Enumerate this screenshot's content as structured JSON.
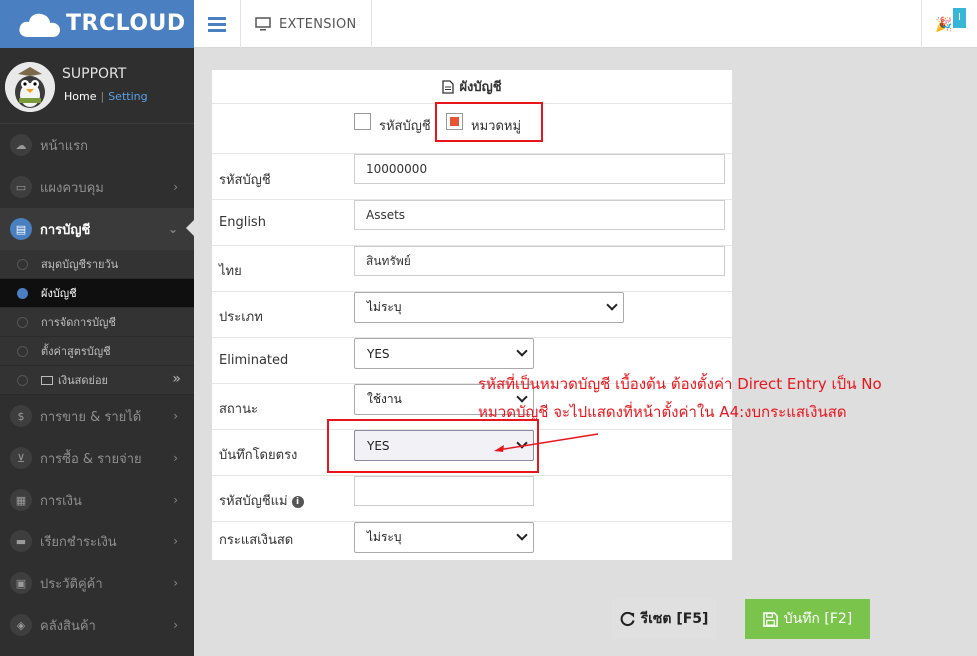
{
  "header": {
    "brand": "TRCLOUD",
    "extension_label": "EXTENSION",
    "notify_badge": "I"
  },
  "profile": {
    "name": "SUPPORT",
    "home": "Home",
    "separator": "|",
    "setting": "Setting"
  },
  "nav": {
    "items": [
      {
        "label": "หน้าแรก",
        "icon": "cloud-icon"
      },
      {
        "label": "แผงควบคุม",
        "icon": "monitor-icon"
      },
      {
        "label": "การบัญชี",
        "icon": "book-icon"
      },
      {
        "label": "การขาย & รายได้",
        "icon": "dollar-icon"
      },
      {
        "label": "การซื้อ & รายจ่าย",
        "icon": "cart-icon"
      },
      {
        "label": "การเงิน",
        "icon": "calendar-icon"
      },
      {
        "label": "เรียกชำระเงิน",
        "icon": "card-icon"
      },
      {
        "label": "ประวัติคู่ค้า",
        "icon": "contact-icon"
      },
      {
        "label": "คลังสินค้า",
        "icon": "boxes-icon"
      }
    ],
    "sub_items": [
      {
        "label": "สมุดบัญชีรายวัน"
      },
      {
        "label": "ผังบัญชี"
      },
      {
        "label": "การจัดการบัญชี"
      },
      {
        "label": "ตั้งค่าสูตรบัญชี"
      },
      {
        "label": "เงินสดย่อย"
      }
    ]
  },
  "form": {
    "title": "ผังบัญชี",
    "check_account_code": "รหัสบัญชี",
    "check_category": "หมวดหมู่",
    "fields": {
      "code_label": "รหัสบัญชี",
      "code_value": "10000000",
      "english_label": "English",
      "english_value": "Assets",
      "thai_label": "ไทย",
      "thai_value": "สินทรัพย์",
      "type_label": "ประเภท",
      "type_value": "ไม่ระบุ",
      "eliminated_label": "Eliminated",
      "eliminated_value": "YES",
      "status_label": "สถานะ",
      "status_value": "ใช้งาน",
      "direct_label": "บันทึกโดยตรง",
      "direct_value": "YES",
      "parent_label": "รหัสบัญชีแม่",
      "parent_value": "",
      "cashflow_label": "กระแสเงินสด",
      "cashflow_value": "ไม่ระบุ"
    }
  },
  "annotation": {
    "line1": "รหัสที่เป็นหมวดบัญชี เบื้องต้น ต้องตั้งค่า Direct Entry เป็น No",
    "line2": "หมวดบัญชี จะไปแสดงที่หน้าตั้งค่าใน A4:งบกระแสเงินสด",
    "color": "#e8161c"
  },
  "buttons": {
    "reset": "รีเซต [F5]",
    "save": "บันทึก [F2]"
  },
  "colors": {
    "brand": "#4a7fc1",
    "sidebar": "#2f2f2f",
    "save": "#7bc44c",
    "highlight": "#e8161c"
  }
}
